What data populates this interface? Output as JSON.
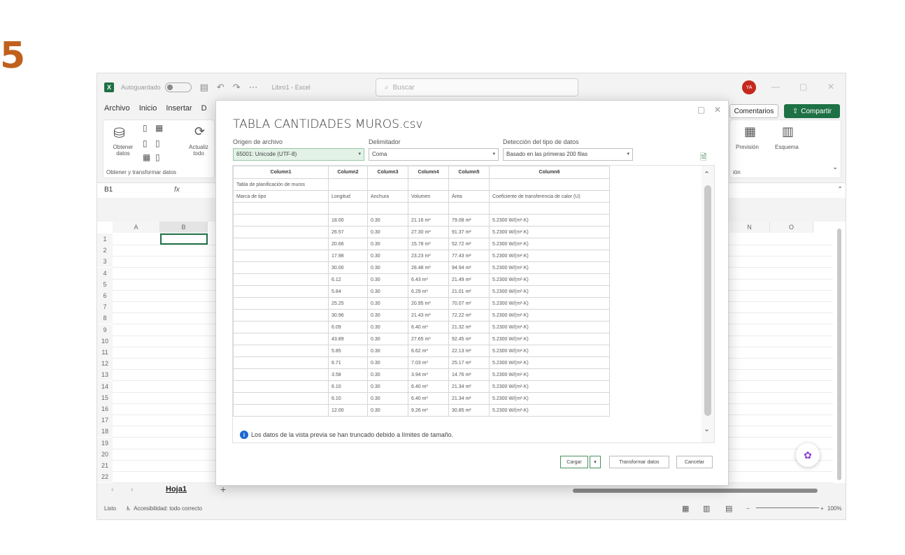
{
  "step": "5",
  "window": {
    "autosave_label": "Autoguardado",
    "doc_title": "Libro1 - Excel",
    "search_placeholder": "Buscar",
    "avatar_initials": "YA"
  },
  "menu": [
    "Archivo",
    "Inicio",
    "Insertar",
    "D"
  ],
  "ribbon": {
    "obtener_label": "Obtener datos",
    "actualizar_label": "Actualiz todo",
    "group_label": "Obtener y transformar datos",
    "prevision_label": "Previsión",
    "esquema_label": "Esquema",
    "group_right_label": "ión",
    "comments_label": "Comentarios",
    "share_label": "Compartir"
  },
  "formula": {
    "namebox": "B1",
    "fx": "fx"
  },
  "grid": {
    "columns_left": [
      "A",
      "B"
    ],
    "columns_right": [
      "N",
      "O"
    ],
    "rows": [
      "1",
      "2",
      "3",
      "4",
      "5",
      "6",
      "7",
      "8",
      "9",
      "10",
      "11",
      "12",
      "13",
      "14",
      "15",
      "16",
      "17",
      "18",
      "19",
      "20",
      "21",
      "22"
    ]
  },
  "sheet_tab": "Hoja1",
  "status": {
    "ready": "Listo",
    "accessibility": "Accesibilidad: todo correcto",
    "zoom": "100%"
  },
  "dialog": {
    "title": "TABLA CANTIDADES MUROS.csv",
    "origin_label": "Origen de archivo",
    "origin_value": "65001: Unicode (UTF-8)",
    "delimiter_label": "Delimitador",
    "delimiter_value": "Coma",
    "detection_label": "Detección del tipo de datos",
    "detection_value": "Basado en las primeras 200 filas",
    "headers": [
      "Column1",
      "Column2",
      "Column3",
      "Column4",
      "Column5",
      "Column6"
    ],
    "meta_rows": [
      [
        "Tabla de planificación de muros",
        "",
        "",
        "",
        "",
        ""
      ],
      [
        "Marca de tipo",
        "Longitud",
        "Anchura",
        "Volumen",
        "Área",
        "Coeficiente de transferencia de calor (U)"
      ],
      [
        "",
        "",
        "",
        "",
        "",
        ""
      ]
    ],
    "rows": [
      [
        "",
        "18.00",
        "0.30",
        "21.16 m³",
        "79.08 m²",
        "5.2300 W/(m²·K)"
      ],
      [
        "",
        "26.57",
        "0.30",
        "27.30 m³",
        "91.37 m²",
        "5.2300 W/(m²·K)"
      ],
      [
        "",
        "20.66",
        "0.30",
        "15.78 m³",
        "52.72 m²",
        "5.2300 W/(m²·K)"
      ],
      [
        "",
        "17.98",
        "0.30",
        "23.23 m³",
        "77.43 m²",
        "5.2300 W/(m²·K)"
      ],
      [
        "",
        "30.00",
        "0.30",
        "28.48 m³",
        "94.94 m²",
        "5.2300 W/(m²·K)"
      ],
      [
        "",
        "6.12",
        "0.30",
        "6.43 m³",
        "21.49 m²",
        "5.2300 W/(m²·K)"
      ],
      [
        "",
        "5.84",
        "0.30",
        "6.29 m³",
        "21.01 m²",
        "5.2300 W/(m²·K)"
      ],
      [
        "",
        "25.25",
        "0.30",
        "20.95 m³",
        "70.07 m²",
        "5.2300 W/(m²·K)"
      ],
      [
        "",
        "30.96",
        "0.30",
        "21.43 m³",
        "72.22 m²",
        "5.2300 W/(m²·K)"
      ],
      [
        "",
        "6.09",
        "0.30",
        "6.40 m³",
        "21.32 m²",
        "5.2300 W/(m²·K)"
      ],
      [
        "",
        "43.89",
        "0.30",
        "27.65 m³",
        "92.45 m²",
        "5.2300 W/(m²·K)"
      ],
      [
        "",
        "5.85",
        "0.30",
        "6.62 m³",
        "22.13 m²",
        "5.2300 W/(m²·K)"
      ],
      [
        "",
        "6.71",
        "0.30",
        "7.03 m³",
        "25.17 m²",
        "5.2300 W/(m²·K)"
      ],
      [
        "",
        "3.58",
        "0.30",
        "3.94 m³",
        "14.76 m²",
        "5.2300 W/(m²·K)"
      ],
      [
        "",
        "6.10",
        "0.30",
        "6.40 m³",
        "21.34 m²",
        "5.2300 W/(m²·K)"
      ],
      [
        "",
        "6.10",
        "0.30",
        "6.40 m³",
        "21.34 m²",
        "5.2300 W/(m²·K)"
      ],
      [
        "",
        "12.00",
        "0.30",
        "9.26 m³",
        "30.85 m²",
        "5.2300 W/(m²·K)"
      ]
    ],
    "info": "Los datos de la vista previa se han truncado debido a límites de tamaño.",
    "load_label": "Cargar",
    "transform_label": "Transformar datos",
    "cancel_label": "Cancelar"
  },
  "colors": {
    "excel_green": "#1e7145",
    "info_blue": "#1967d2",
    "step_orange": "#c0601c"
  }
}
